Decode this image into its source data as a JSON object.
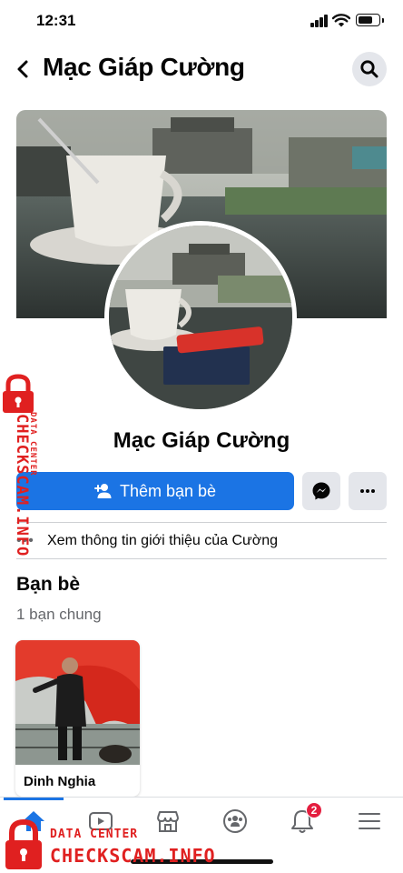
{
  "status_bar": {
    "time": "12:31"
  },
  "header": {
    "title": "Mạc Giáp Cường"
  },
  "profile": {
    "name": "Mạc Giáp Cường"
  },
  "actions": {
    "add_friend_label": "Thêm bạn bè",
    "messenger_icon": "messenger-icon",
    "more_icon": "more-icon"
  },
  "about": {
    "label": "Xem thông tin giới thiệu của Cường"
  },
  "friends": {
    "title": "Bạn bè",
    "mutual_count": "1 bạn chung",
    "cards": [
      {
        "name": "Dinh Nghia"
      }
    ]
  },
  "bottom_nav": {
    "items": [
      "home-icon",
      "video-icon",
      "marketplace-icon",
      "groups-icon",
      "notifications-icon",
      "menu-icon"
    ],
    "notification_badge": "2"
  },
  "watermark": {
    "small_text": "DATA CENTER",
    "big_text": "CHECKSCAM.INFO"
  },
  "colors": {
    "accent": "#1b74e4",
    "badge": "#e41e3f",
    "secondary_bg": "#e4e6eb",
    "watermark": "#e02020"
  }
}
